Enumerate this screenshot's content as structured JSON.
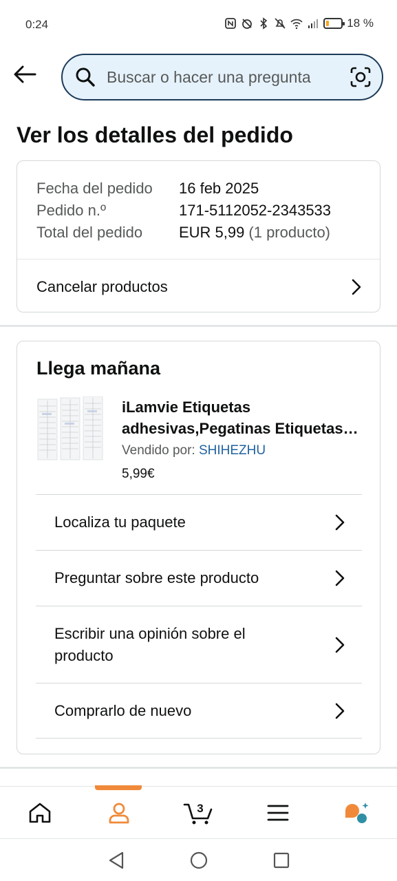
{
  "status": {
    "time": "0:24",
    "battery_text": "18 %",
    "battery_level": 0.18
  },
  "search": {
    "placeholder": "Buscar o hacer una pregunta"
  },
  "page": {
    "title": "Ver los detalles del pedido"
  },
  "order": {
    "date_label": "Fecha del pedido",
    "date_value": "16 feb 2025",
    "number_label": "Pedido n.º",
    "number_value": "171-5112052-2343533",
    "total_label": "Total del pedido",
    "total_value": "EUR 5,99",
    "total_count": "(1 producto)",
    "cancel_label": "Cancelar productos"
  },
  "shipment": {
    "title": "Llega mañana",
    "product_title": "iLamvie Etiquetas adhesivas,Pegatinas Etiquetas Adhesivas",
    "seller_prefix": "Vendido por: ",
    "seller_name": "SHIHEZHU",
    "price": "5,99€",
    "actions": [
      {
        "label": "Localiza tu paquete"
      },
      {
        "label": "Preguntar sobre este producto"
      },
      {
        "label": "Escribir una opinión sobre el producto"
      },
      {
        "label": "Comprarlo de nuevo"
      }
    ]
  },
  "bottom_nav": {
    "items": [
      "home-icon",
      "account-icon",
      "cart-icon",
      "menu-icon",
      "rufus-icon"
    ],
    "cart_count": "3",
    "accent_color": "#f08a3a"
  },
  "colors": {
    "link": "#2162a1",
    "search_border": "#1b3a57",
    "search_bg": "#e6f2fb"
  }
}
